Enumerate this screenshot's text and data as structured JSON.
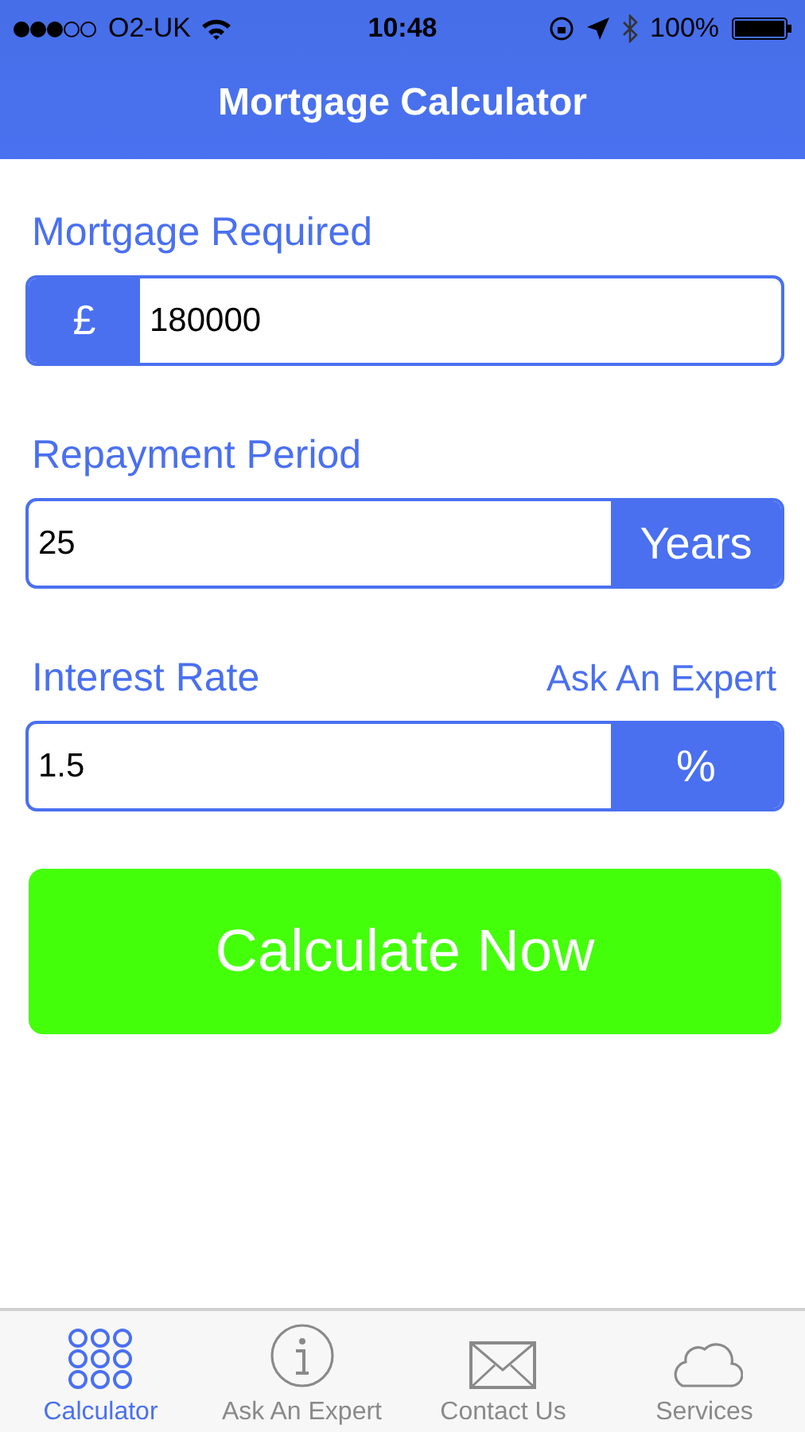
{
  "status_bar": {
    "carrier": "O2-UK",
    "time": "10:48",
    "battery": "100%"
  },
  "nav_bar": {
    "title": "Mortgage Calculator"
  },
  "fields": [
    {
      "label": "Mortgage Required",
      "value": "180000",
      "affix": "£",
      "kind": "prefix"
    },
    {
      "label": "Repayment Period",
      "value": "25",
      "affix": "Years",
      "kind": "suffix"
    },
    {
      "label": "Interest Rate",
      "link": "Ask An Expert",
      "value": "1.5",
      "affix": "%",
      "kind": "suffix"
    }
  ],
  "calculate_button": "Calculate Now",
  "tab_bar": [
    {
      "label": "Calculator",
      "selected": true
    },
    {
      "label": "Ask An Expert",
      "selected": false
    },
    {
      "label": "Contact Us",
      "selected": false
    },
    {
      "label": "Services",
      "selected": false
    }
  ]
}
